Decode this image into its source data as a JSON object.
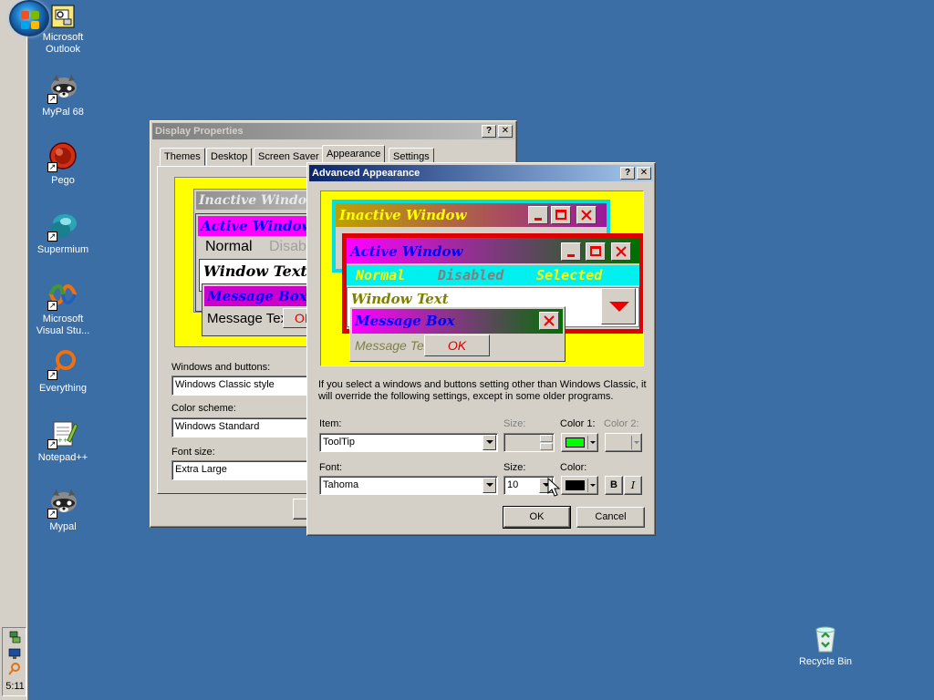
{
  "desktop": {
    "icons": [
      {
        "label": "Microsoft Outlook",
        "icon": "outlook-icon"
      },
      {
        "label": "MyPal 68",
        "icon": "raccoon-icon"
      },
      {
        "label": "Pego",
        "icon": "pego-icon"
      },
      {
        "label": "Supermium",
        "icon": "supermium-icon"
      },
      {
        "label": "Microsoft Visual Stu...",
        "icon": "visual-studio-icon"
      },
      {
        "label": "Everything",
        "icon": "everything-icon"
      },
      {
        "label": "Notepad++",
        "icon": "notepadpp-icon"
      },
      {
        "label": "Mypal",
        "icon": "raccoon-icon"
      },
      {
        "label": "Recycle Bin",
        "icon": "recycle-bin-icon"
      }
    ]
  },
  "taskbar": {
    "clock": "5:11",
    "tray_icons": [
      "network-icon",
      "monitor-icon",
      "search-icon"
    ]
  },
  "display_properties": {
    "title": "Display Properties",
    "tabs": [
      "Themes",
      "Desktop",
      "Screen Saver",
      "Appearance",
      "Settings"
    ],
    "selected_tab": "Appearance",
    "preview": {
      "inactive": "Inactive Window",
      "active": "Active Window",
      "normal": "Normal",
      "disabled": "Disabled",
      "window_text": "Window Text",
      "message_box": "Message Box",
      "message_text": "Message Text",
      "ok": "OK"
    },
    "windows_buttons_label": "Windows and buttons:",
    "windows_buttons_value": "Windows Classic style",
    "color_scheme_label": "Color scheme:",
    "color_scheme_value": "Windows Standard",
    "font_size_label": "Font size:",
    "font_size_value": "Extra Large"
  },
  "advanced": {
    "title": "Advanced Appearance",
    "preview": {
      "inactive": "Inactive Window",
      "active": "Active Window",
      "normal": "Normal",
      "disabled": "Disabled",
      "selected": "Selected",
      "window_text": "Window Text",
      "message_box": "Message Box",
      "message_text": "Message Text",
      "ok": "OK"
    },
    "info_text": "If you select a windows and buttons setting other than Windows Classic, it will override the following settings, except in some older programs.",
    "item_label": "Item:",
    "item_value": "ToolTip",
    "size_label": "Size:",
    "color1_label": "Color 1:",
    "color2_label": "Color 2:",
    "font_label": "Font:",
    "font_value": "Tahoma",
    "font_size_label": "Size:",
    "font_size_value": "10",
    "color_label": "Color:",
    "bold": "B",
    "italic": "I",
    "ok": "OK",
    "cancel": "Cancel",
    "colors": {
      "color1": "#00ff00",
      "font_color": "#000000"
    }
  },
  "title_buttons": {
    "help": "?",
    "close": "✕"
  }
}
